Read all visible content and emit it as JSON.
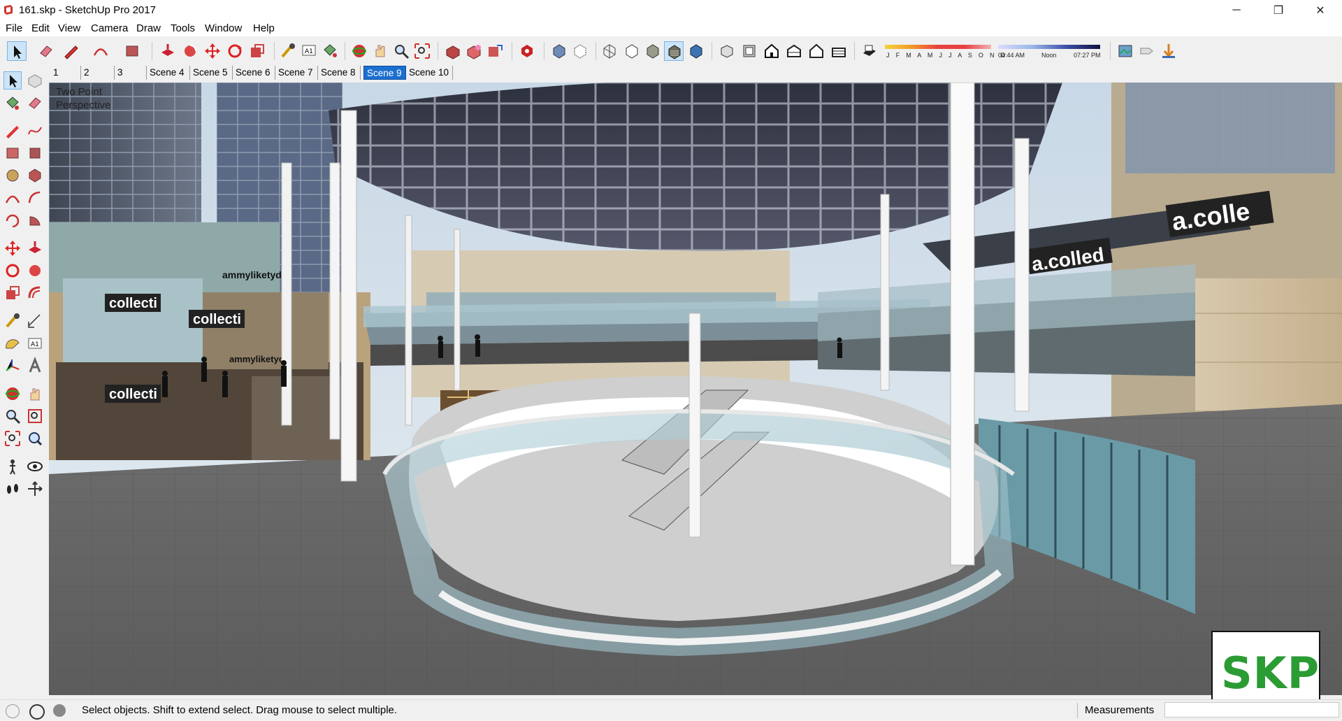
{
  "window": {
    "title": "161.skp - SketchUp Pro 2017",
    "minimize_label": "─",
    "restore_label": "❐",
    "close_label": "✕"
  },
  "menu": [
    "File",
    "Edit",
    "View",
    "Camera",
    "Draw",
    "Tools",
    "Window",
    "Help"
  ],
  "shadows": {
    "months": "J F M A M J J A S O N D",
    "time_start": "04:44 AM",
    "time_noon": "Noon",
    "time_end": "07:27 PM"
  },
  "scenes": [
    "1",
    "2",
    "3",
    "Scene 4",
    "Scene 5",
    "Scene 6",
    "Scene 7",
    "Scene 8",
    "Scene 9",
    "Scene 10"
  ],
  "active_scene": "Scene 9",
  "viewport": {
    "camera_label_line1": "Two Point",
    "camera_label_line2": "Perspective",
    "store_signs": [
      "collecti",
      "collecti",
      "collecti",
      "ammyliketyd",
      "ammyliketyd",
      "a.colled",
      "a.colle"
    ]
  },
  "status": {
    "hint": "Select objects. Shift to extend select. Drag mouse to select multiple.",
    "measurements_label": "Measurements",
    "measurements_value": ""
  },
  "watermark": {
    "text": "SKP",
    "color": "#2b9b34"
  },
  "colors": {
    "accent": "#1c6fcf",
    "background": "#f0f0f0"
  }
}
